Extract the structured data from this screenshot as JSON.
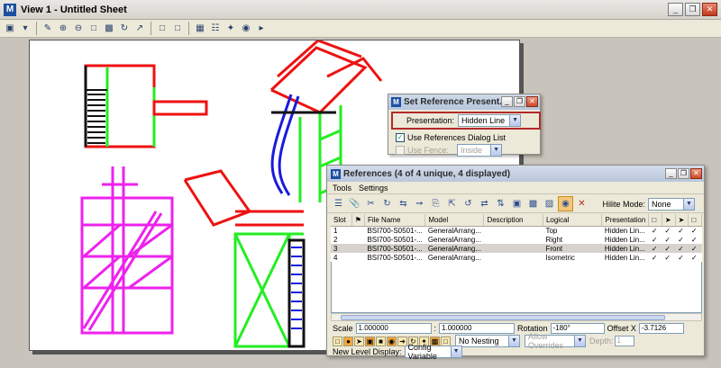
{
  "main_window": {
    "title": "View 1 - Untitled Sheet",
    "buttons": [
      "_",
      "❐",
      "✕"
    ]
  },
  "view_toolbar": {
    "icons": [
      "view-group-icon",
      "dropdown-icon",
      "update-view-icon",
      "zoom-in-icon",
      "zoom-out-icon",
      "window-area-icon",
      "fit-view-icon",
      "rotate-view-icon",
      "pan-view-icon",
      "view-previous-icon",
      "view-next-icon",
      "copy-view-icon",
      "view-attributes-icon",
      "display-style-icon",
      "camera-icon",
      "clip-volume-icon"
    ]
  },
  "presentation_dialog": {
    "title": "Set Reference Present...",
    "presentation_label": "Presentation:",
    "presentation_value": "Hidden Line",
    "use_refs_label": "Use References Dialog List",
    "use_refs_checked": true,
    "use_fence_label": "Use Fence:",
    "use_fence_value": "Inside",
    "buttons": [
      "_",
      "❐",
      "✕"
    ]
  },
  "references_dialog": {
    "title": "References (4 of 4 unique, 4 displayed)",
    "menu": [
      "Tools",
      "Settings"
    ],
    "hilite_label": "Hilite Mode:",
    "hilite_value": "None",
    "columns": [
      "Slot",
      "⚑",
      "File Name",
      "Model",
      "Description",
      "Logical",
      "Presentation",
      "",
      "",
      "",
      ""
    ],
    "rows": [
      {
        "slot": "1",
        "file": "BSI700-S0501-...",
        "model": "GeneralArrang...",
        "description": "",
        "logical": "Top",
        "presentation": "Hidden Lin...",
        "c1": "✓",
        "c2": "✓",
        "c3": "✓",
        "c4": "✓"
      },
      {
        "slot": "2",
        "file": "BSI700-S0501-...",
        "model": "GeneralArrang...",
        "description": "",
        "logical": "Right",
        "presentation": "Hidden Lin...",
        "c1": "✓",
        "c2": "✓",
        "c3": "✓",
        "c4": "✓"
      },
      {
        "slot": "3",
        "file": "BSI700-S0501-...",
        "model": "GeneralArrang...",
        "description": "",
        "logical": "Front",
        "presentation": "Hidden Lin...",
        "c1": "✓",
        "c2": "✓",
        "c3": "✓",
        "c4": "✓"
      },
      {
        "slot": "4",
        "file": "BSI700-S0501-...",
        "model": "GeneralArrang...",
        "description": "",
        "logical": "Isometric",
        "presentation": "Hidden Lin...",
        "c1": "✓",
        "c2": "✓",
        "c3": "✓",
        "c4": "✓"
      }
    ],
    "selected_row": 2,
    "scale_label": "Scale",
    "scale_1": "1.000000",
    "scale_sep": ":",
    "scale_2": "1.000000",
    "rotation_label": "Rotation",
    "rotation_value": "-180°",
    "offset_label": "Offset X",
    "offset_value": "-3.7126",
    "nesting_value": "No Nesting",
    "overrides_value": "Allow Overrides",
    "depth_label": "Depth:",
    "depth_value": "1",
    "new_level_label": "New Level Display:",
    "new_level_value": "Config Variable"
  },
  "colors": {
    "red": "#ee1111",
    "green": "#22ee22",
    "blue": "#1a1adf",
    "magenta": "#ee22ee",
    "black": "#111111",
    "highlight_border": "#b22a2a"
  }
}
